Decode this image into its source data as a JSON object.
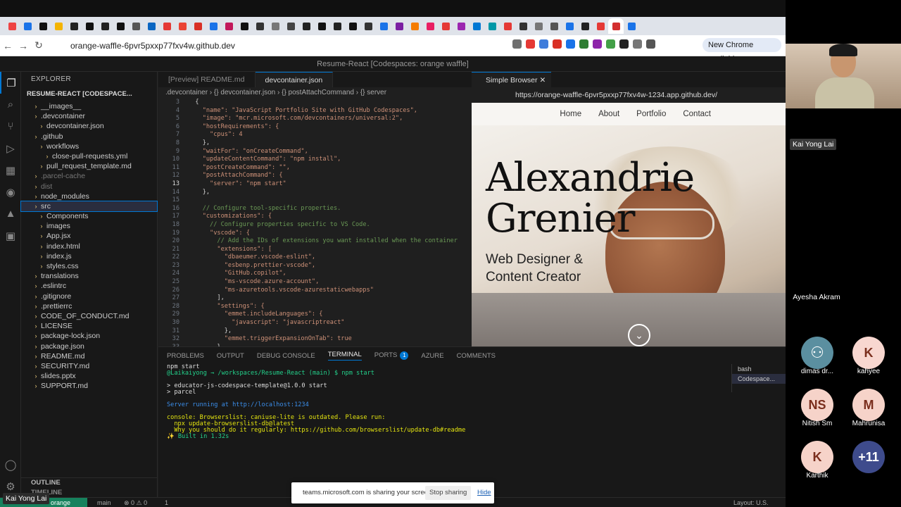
{
  "chrome": {
    "url": "orange-waffle-6pvr5pxxp77fxv4w.github.dev",
    "new_chrome": "New Chrome available"
  },
  "vscode": {
    "title": "Resume-React [Codespaces: orange waffle]",
    "explorer_header": "EXPLORER",
    "project": "RESUME-REACT [CODESPACE...",
    "tree": [
      {
        "label": "__images__",
        "indent": 1,
        "dim": false
      },
      {
        "label": ".devcontainer",
        "indent": 1,
        "dim": false
      },
      {
        "label": "devcontainer.json",
        "indent": 2,
        "dim": false
      },
      {
        "label": ".github",
        "indent": 1,
        "dim": false
      },
      {
        "label": "workflows",
        "indent": 2,
        "dim": false
      },
      {
        "label": "close-pull-requests.yml",
        "indent": 3,
        "dim": false
      },
      {
        "label": "pull_request_template.md",
        "indent": 2,
        "dim": false
      },
      {
        "label": ".parcel-cache",
        "indent": 1,
        "dim": true
      },
      {
        "label": "dist",
        "indent": 1,
        "dim": true
      },
      {
        "label": "node_modules",
        "indent": 1,
        "dim": false
      },
      {
        "label": "src",
        "indent": 1,
        "dim": false,
        "sel": true
      },
      {
        "label": "Components",
        "indent": 2,
        "dim": false
      },
      {
        "label": "images",
        "indent": 2,
        "dim": false
      },
      {
        "label": "App.jsx",
        "indent": 2,
        "dim": false
      },
      {
        "label": "index.html",
        "indent": 2,
        "dim": false
      },
      {
        "label": "index.js",
        "indent": 2,
        "dim": false
      },
      {
        "label": "styles.css",
        "indent": 2,
        "dim": false
      },
      {
        "label": "translations",
        "indent": 1,
        "dim": false
      },
      {
        "label": ".eslintrc",
        "indent": 1,
        "dim": false
      },
      {
        "label": ".gitignore",
        "indent": 1,
        "dim": false
      },
      {
        "label": ".prettierrc",
        "indent": 1,
        "dim": false
      },
      {
        "label": "CODE_OF_CONDUCT.md",
        "indent": 1,
        "dim": false
      },
      {
        "label": "LICENSE",
        "indent": 1,
        "dim": false
      },
      {
        "label": "package-lock.json",
        "indent": 1,
        "dim": false
      },
      {
        "label": "package.json",
        "indent": 1,
        "dim": false
      },
      {
        "label": "README.md",
        "indent": 1,
        "dim": false
      },
      {
        "label": "SECURITY.md",
        "indent": 1,
        "dim": false
      },
      {
        "label": "slides.pptx",
        "indent": 1,
        "dim": false
      },
      {
        "label": "SUPPORT.md",
        "indent": 1,
        "dim": false
      }
    ],
    "outline": "OUTLINE",
    "timeline": "TIMELINE",
    "tab1": "[Preview] README.md",
    "tab2": "devcontainer.json",
    "crumbs": ".devcontainer  ›  {} devcontainer.json  ›  {} postAttachCommand  ›  {} server",
    "code": [
      {
        "no": "3",
        "text": "  {"
      },
      {
        "no": "4",
        "text": "    \"name\": \"JavaScript Portfolio Site with GitHub Codespaces\","
      },
      {
        "no": "5",
        "text": "    \"image\": \"mcr.microsoft.com/devcontainers/universal:2\","
      },
      {
        "no": "6",
        "text": "    \"hostRequirements\": {"
      },
      {
        "no": "7",
        "text": "      \"cpus\": 4"
      },
      {
        "no": "8",
        "text": "    },"
      },
      {
        "no": "9",
        "text": "    \"waitFor\": \"onCreateCommand\","
      },
      {
        "no": "10",
        "text": "    \"updateContentCommand\": \"npm install\","
      },
      {
        "no": "11",
        "text": "    \"postCreateCommand\": \"\","
      },
      {
        "no": "12",
        "text": "    \"postAttachCommand\": {"
      },
      {
        "no": "13",
        "text": "      \"server\": \"npm start\""
      },
      {
        "no": "14",
        "text": "    },"
      },
      {
        "no": "15",
        "text": ""
      },
      {
        "no": "16",
        "text": "    // Configure tool-specific properties."
      },
      {
        "no": "17",
        "text": "    \"customizations\": {"
      },
      {
        "no": "18",
        "text": "      // Configure properties specific to VS Code."
      },
      {
        "no": "19",
        "text": "      \"vscode\": {"
      },
      {
        "no": "20",
        "text": "        // Add the IDs of extensions you want installed when the container"
      },
      {
        "no": "21",
        "text": "        \"extensions\": ["
      },
      {
        "no": "22",
        "text": "          \"dbaeumer.vscode-eslint\","
      },
      {
        "no": "23",
        "text": "          \"esbenp.prettier-vscode\","
      },
      {
        "no": "24",
        "text": "          \"GitHub.copilot\","
      },
      {
        "no": "25",
        "text": "          \"ms-vscode.azure-account\","
      },
      {
        "no": "26",
        "text": "          \"ms-azuretools.vscode-azurestaticwebapps\""
      },
      {
        "no": "27",
        "text": "        ],"
      },
      {
        "no": "28",
        "text": "        \"settings\": {"
      },
      {
        "no": "29",
        "text": "          \"emmet.includeLanguages\": {"
      },
      {
        "no": "30",
        "text": "            \"javascript\": \"javascriptreact\""
      },
      {
        "no": "31",
        "text": "          },"
      },
      {
        "no": "32",
        "text": "          \"emmet.triggerExpansionOnTab\": true"
      },
      {
        "no": "33",
        "text": "        }"
      }
    ],
    "browser_tab": "Simple Browser",
    "browser_url": "https://orange-waffle-6pvr5pxxp77fxv4w-1234.app.github.dev/",
    "panel_tabs": [
      "PROBLEMS",
      "OUTPUT",
      "DEBUG CONSOLE",
      "TERMINAL",
      "PORTS",
      "AZURE",
      "COMMENTS"
    ],
    "ports_badge": "1",
    "terminal": [
      {
        "text": "npm start",
        "cls": ""
      },
      {
        "text": "@Laikaiyong → /workspaces/Resume-React (main) $ npm start",
        "cls": "g"
      },
      {
        "text": "",
        "cls": ""
      },
      {
        "text": "> educator-js-codespace-template@1.0.0 start",
        "cls": ""
      },
      {
        "text": "> parcel",
        "cls": ""
      },
      {
        "text": "",
        "cls": ""
      },
      {
        "text": "Server running at http://localhost:1234",
        "cls": "b"
      },
      {
        "text": "",
        "cls": ""
      },
      {
        "text": "console: Browserslist: caniuse-lite is outdated. Please run:",
        "cls": "y"
      },
      {
        "text": "  npx update-browserslist-db@latest",
        "cls": "y"
      },
      {
        "text": "  Why you should do it regularly: https://github.com/browserslist/update-db#readme",
        "cls": "y"
      },
      {
        "text": "✨ Built in 1.32s",
        "cls": "g"
      }
    ],
    "term_list": [
      "bash",
      "Codespace..."
    ],
    "status_remote": "orange waffle",
    "status_branch": "main",
    "status_errors": "⊗ 0  ⚠ 0",
    "status_ports": "1",
    "status_layout": "Layout: U.S."
  },
  "site": {
    "nav": [
      "Home",
      "About",
      "Portfolio",
      "Contact"
    ],
    "name_line1": "Alexandrie",
    "name_line2": "Grenier",
    "role_line1": "Web Designer &",
    "role_line2": "Content Creator"
  },
  "share": {
    "text": "teams.microsoft.com is sharing your screen.",
    "stop": "Stop sharing",
    "hide": "Hide"
  },
  "presenter_tag": "Kai Yong Lai",
  "meeting": {
    "presenter": "Kai Yong Lai",
    "ayesha": "Ayesha Akram",
    "participants": [
      {
        "initials": "",
        "name": "dimas dr...",
        "bg": "#5b8fa0"
      },
      {
        "initials": "K",
        "name": "kahyee",
        "bg": "#f8d7d0"
      },
      {
        "initials": "NS",
        "name": "Nitish Sm",
        "bg": "#f6d3c9"
      },
      {
        "initials": "M",
        "name": "Mahrunisa",
        "bg": "#f6d3c9"
      },
      {
        "initials": "K",
        "name": "Karthik",
        "bg": "#f6d3c9"
      },
      {
        "initials": "+11",
        "name": "",
        "bg": "#3e4b8c"
      }
    ]
  }
}
